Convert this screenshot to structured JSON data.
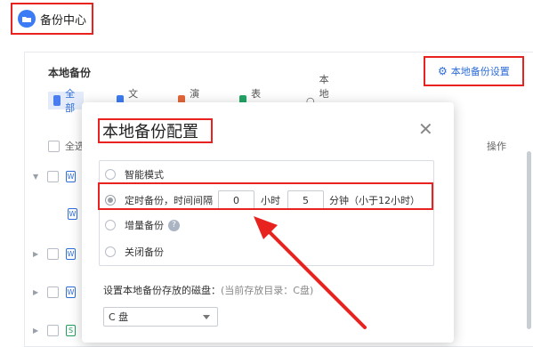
{
  "app": {
    "title": "备份中心"
  },
  "panel": {
    "title": "本地备份",
    "settings_label": "本地备份设置",
    "tabs": [
      {
        "label": "全部",
        "color": "#4a7ef0"
      },
      {
        "label": "文档",
        "color": "#3b7cf6"
      },
      {
        "label": "演示",
        "color": "#e4673a"
      },
      {
        "label": "表格",
        "color": "#22a565"
      },
      {
        "label": "本地备份",
        "color": "#9aa0aa"
      }
    ],
    "select_all": "全选",
    "ops_header": "操作",
    "file_icons": [
      "W",
      "W",
      "W",
      "W",
      "W",
      "S"
    ]
  },
  "dialog": {
    "title": "本地备份配置",
    "options": {
      "smart": "智能模式",
      "timed_prefix": "定时备份，时间间隔",
      "hours_value": "0",
      "hours_unit": "小时",
      "minutes_value": "5",
      "minutes_unit": "分钟（小于12小时）",
      "incremental": "增量备份",
      "off": "关闭备份"
    },
    "disk_label": "设置本地备份存放的磁盘：",
    "disk_hint": "(当前存放目录：C盘)",
    "disk_selected": "C 盘"
  },
  "colors": {
    "highlight": "#e8231f",
    "accent": "#2c6bd8"
  }
}
